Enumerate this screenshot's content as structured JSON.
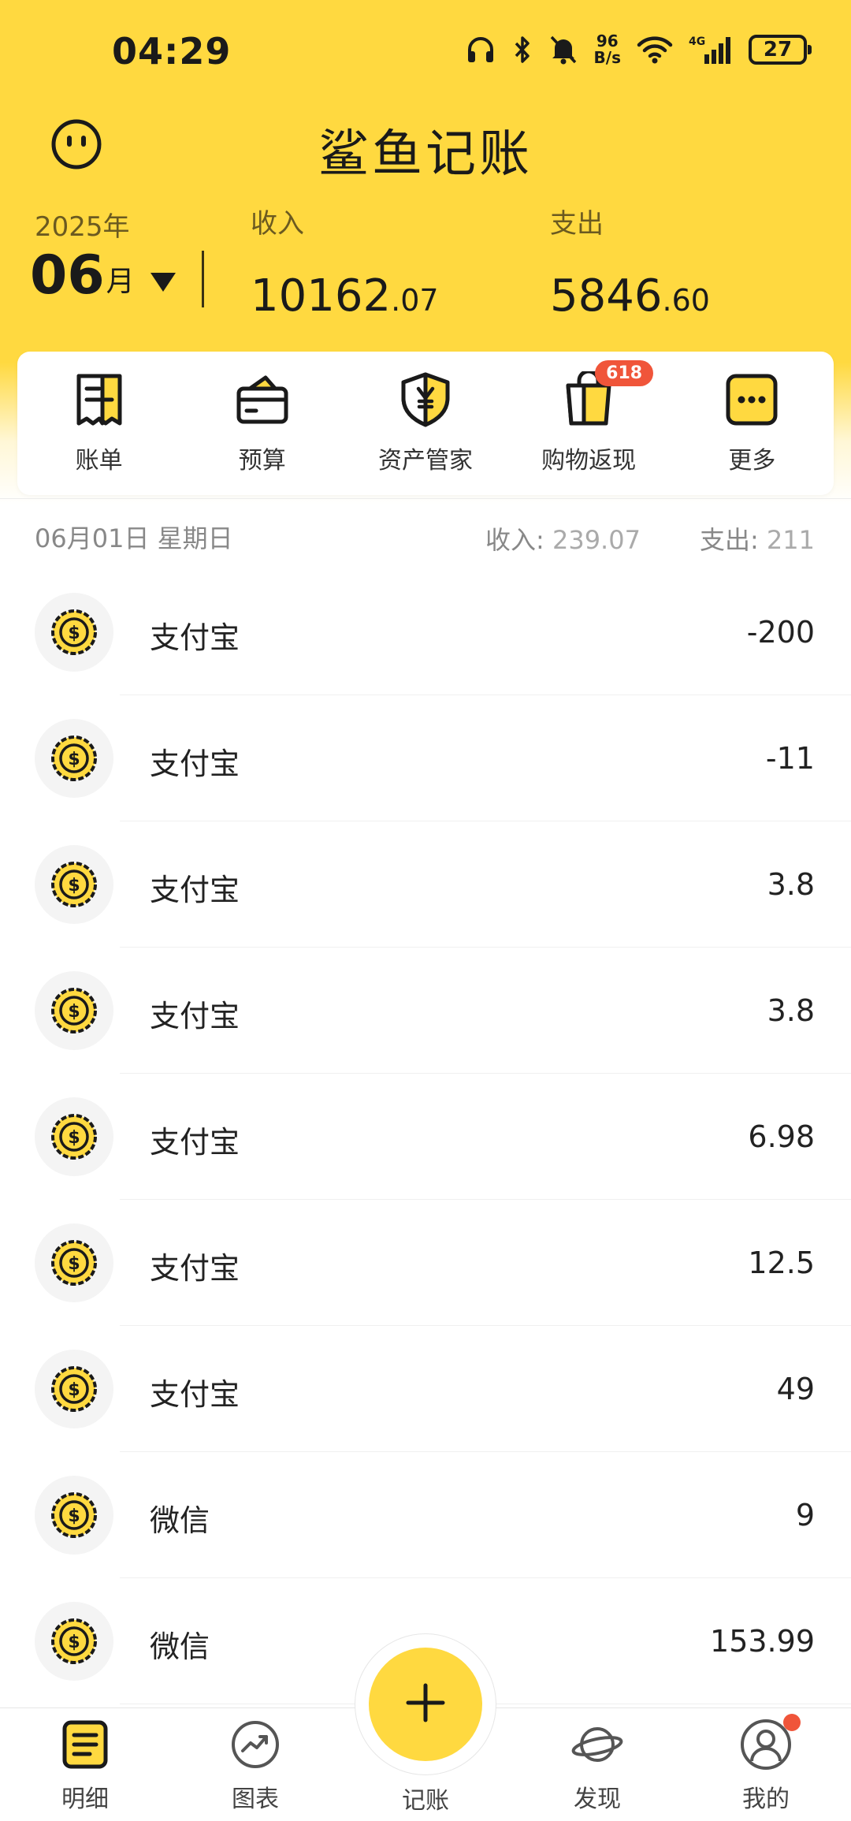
{
  "status_bar": {
    "time": "04:29",
    "net_speed_value": "96",
    "net_speed_unit": "B/s",
    "network": "4G",
    "battery": "27",
    "icons": [
      "headphones-icon",
      "bluetooth-icon",
      "mute-icon",
      "wifi-icon",
      "signal-icon"
    ]
  },
  "header": {
    "app_title": "鲨鱼记账",
    "face_icon": "face-icon",
    "year": "2025年",
    "month": "06",
    "month_unit": "月",
    "income_label": "收入",
    "income_int": "10162",
    "income_dec": ".07",
    "expense_label": "支出",
    "expense_int": "5846",
    "expense_dec": ".60"
  },
  "quick_menu": [
    {
      "label": "账单",
      "icon": "bill-icon"
    },
    {
      "label": "预算",
      "icon": "wallet-icon"
    },
    {
      "label": "资产管家",
      "icon": "shield-yen-icon"
    },
    {
      "label": "购物返现",
      "icon": "shopping-bag-icon",
      "badge": "618"
    },
    {
      "label": "更多",
      "icon": "more-icon"
    }
  ],
  "day": {
    "date": "06月01日 星期日",
    "income_label": "收入:",
    "income_value": "239.07",
    "expense_label": "支出:",
    "expense_value": "211"
  },
  "transactions": [
    {
      "name": "支付宝",
      "amount": "-200"
    },
    {
      "name": "支付宝",
      "amount": "-11"
    },
    {
      "name": "支付宝",
      "amount": "3.8"
    },
    {
      "name": "支付宝",
      "amount": "3.8"
    },
    {
      "name": "支付宝",
      "amount": "6.98"
    },
    {
      "name": "支付宝",
      "amount": "12.5"
    },
    {
      "name": "支付宝",
      "amount": "49"
    },
    {
      "name": "微信",
      "amount": "9"
    },
    {
      "name": "微信",
      "amount": "153.99"
    }
  ],
  "bottom_nav": [
    {
      "label": "明细",
      "icon": "detail-icon"
    },
    {
      "label": "图表",
      "icon": "chart-icon"
    },
    {
      "label": "记账",
      "icon": "plus-icon"
    },
    {
      "label": "发现",
      "icon": "planet-icon"
    },
    {
      "label": "我的",
      "icon": "profile-icon"
    }
  ],
  "colors": {
    "brand_yellow": "#FFD940",
    "badge_red": "#F0553A"
  }
}
